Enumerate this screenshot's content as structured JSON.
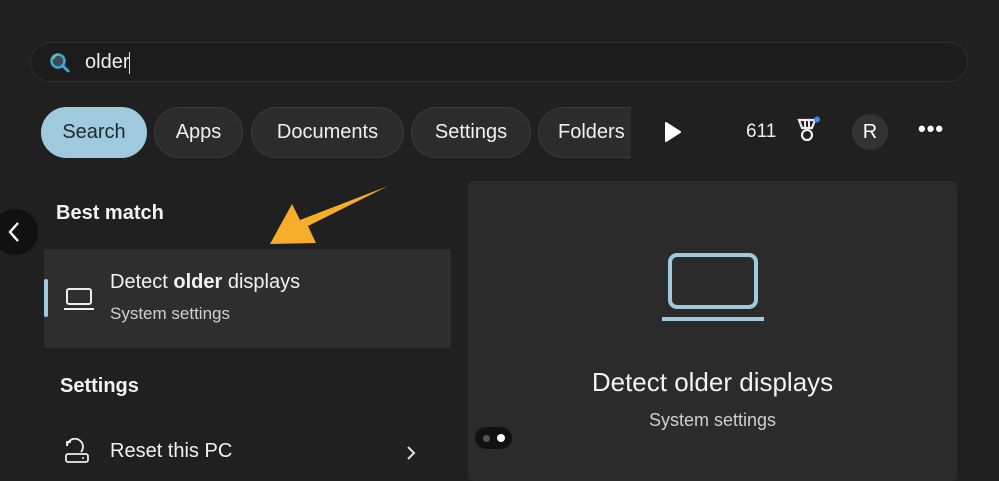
{
  "search": {
    "query": "older"
  },
  "filters": [
    "Search",
    "Apps",
    "Documents",
    "Settings",
    "Folders"
  ],
  "toolbar": {
    "points": "611",
    "avatar": "R"
  },
  "best_match": {
    "header": "Best match",
    "title_pre": "Detect ",
    "title_bold": "older",
    "title_post": " displays",
    "subtitle": "System settings"
  },
  "settings": {
    "header": "Settings",
    "items": [
      {
        "label": "Reset this PC"
      }
    ]
  },
  "preview": {
    "title": "Detect older displays",
    "subtitle": "System settings"
  },
  "colors": {
    "accent": "#9fc9dc",
    "annotation_arrow": "#f5ad2a"
  }
}
